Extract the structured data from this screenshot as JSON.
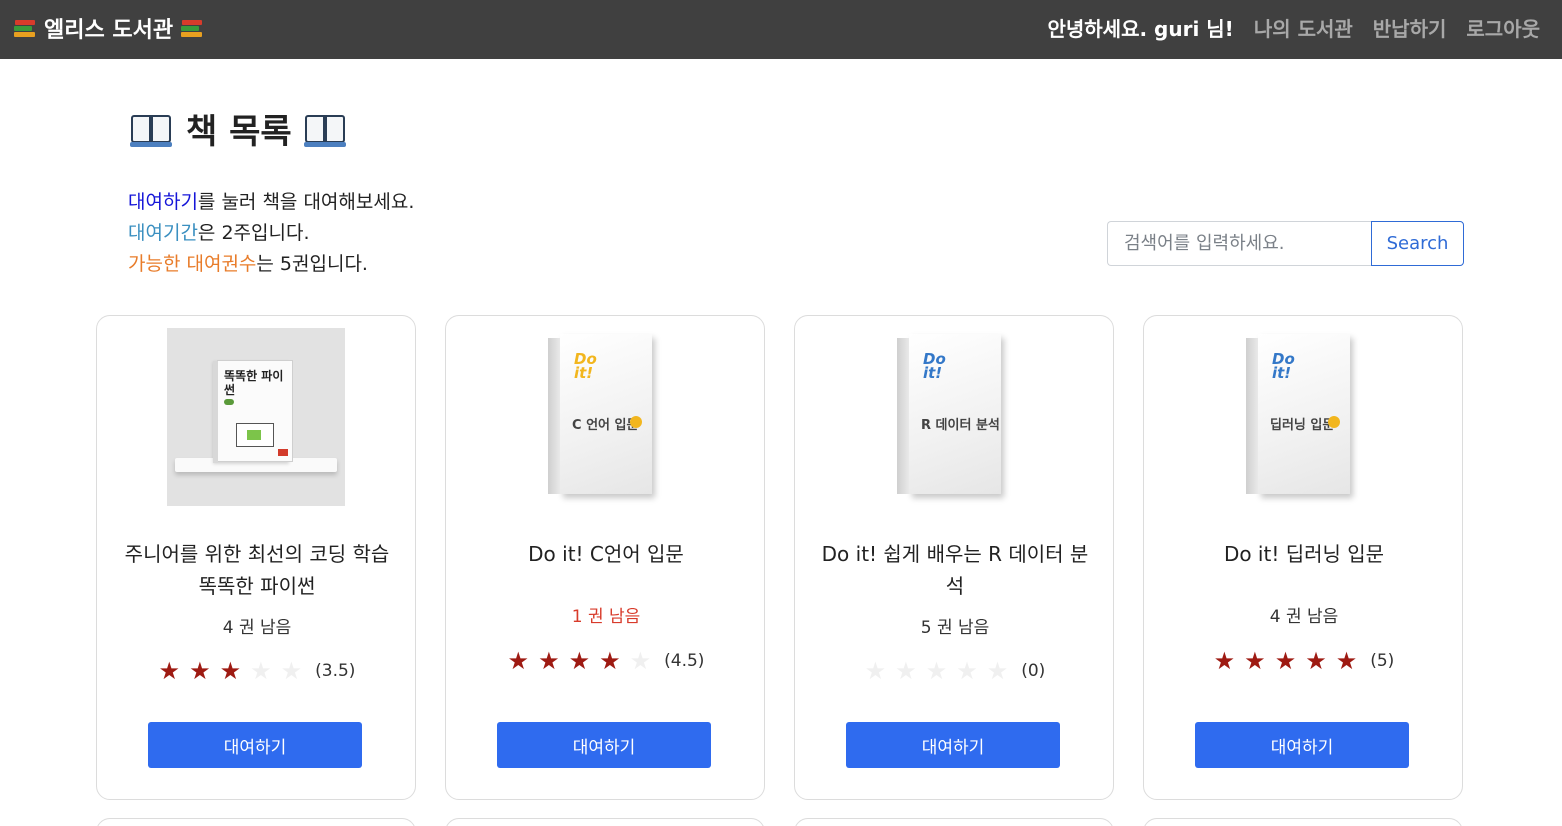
{
  "navbar": {
    "brand": "엘리스 도서관",
    "greeting": "안녕하세요. guri 님!",
    "links": [
      "나의 도서관",
      "반납하기",
      "로그아웃"
    ]
  },
  "page": {
    "title": "책 목록",
    "info": {
      "line1_highlight": "대여하기",
      "line1_rest": "를 눌러 책을 대여해보세요.",
      "line2_highlight": "대여기간",
      "line2_rest": "은 2주입니다.",
      "line3_highlight": "가능한 대여권수",
      "line3_rest": "는 5권입니다."
    }
  },
  "search": {
    "placeholder": "검색어를 입력하세요.",
    "button_label": "Search"
  },
  "books": [
    {
      "title": "주니어를 위한 최선의 코딩 학습 똑똑한 파이썬",
      "remaining": "4 권 남음",
      "rating": 3.5,
      "rating_label": "(3.5)",
      "rent_label": "대여하기",
      "cover_text": "똑똑한 파이썬"
    },
    {
      "title": "Do it! C언어 입문",
      "remaining": "1 권 남음",
      "rating": 4.5,
      "rating_label": "(4.5)",
      "rent_label": "대여하기",
      "cover_text": "C 언어 입문"
    },
    {
      "title": "Do it! 쉽게 배우는 R 데이터 분석",
      "remaining": "5 권 남음",
      "rating": 0,
      "rating_label": "(0)",
      "rent_label": "대여하기",
      "cover_text": "R 데이터 분석"
    },
    {
      "title": "Do it! 딥러닝 입문",
      "remaining": "4 권 남음",
      "rating": 5,
      "rating_label": "(5)",
      "rent_label": "대여하기",
      "cover_text": "딥러닝 입문"
    }
  ],
  "colors": {
    "navbar": "#404040",
    "primary_button": "#2f6bef",
    "star_on": "#9e1a12",
    "low_stock": "#d83b2b"
  }
}
